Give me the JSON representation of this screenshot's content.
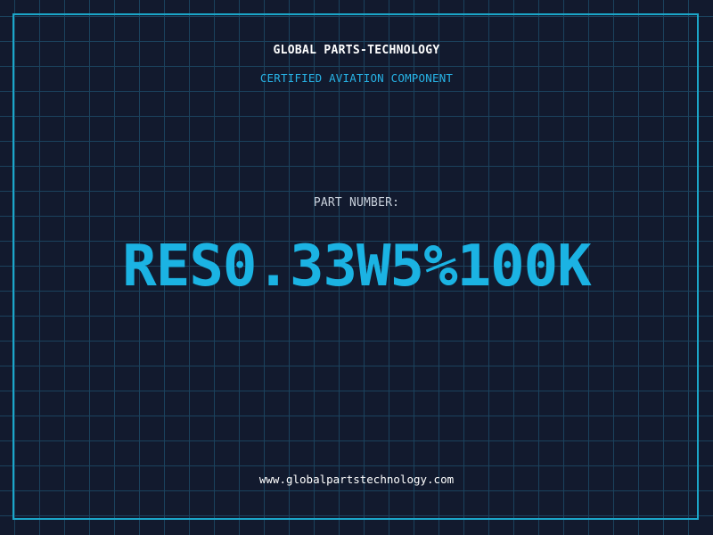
{
  "brand": "GLOBAL PARTS-TECHNOLOGY",
  "subtitle": "CERTIFIED AVIATION COMPONENT",
  "part": {
    "label": "PART NUMBER:",
    "value": "RES0.33W5%100K"
  },
  "footer": {
    "url": "www.globalpartstechnology.com"
  },
  "colors": {
    "background": "#121a2e",
    "grid": "#1d4a66",
    "accent": "#1bb3e3",
    "border": "#1ba6c9"
  }
}
